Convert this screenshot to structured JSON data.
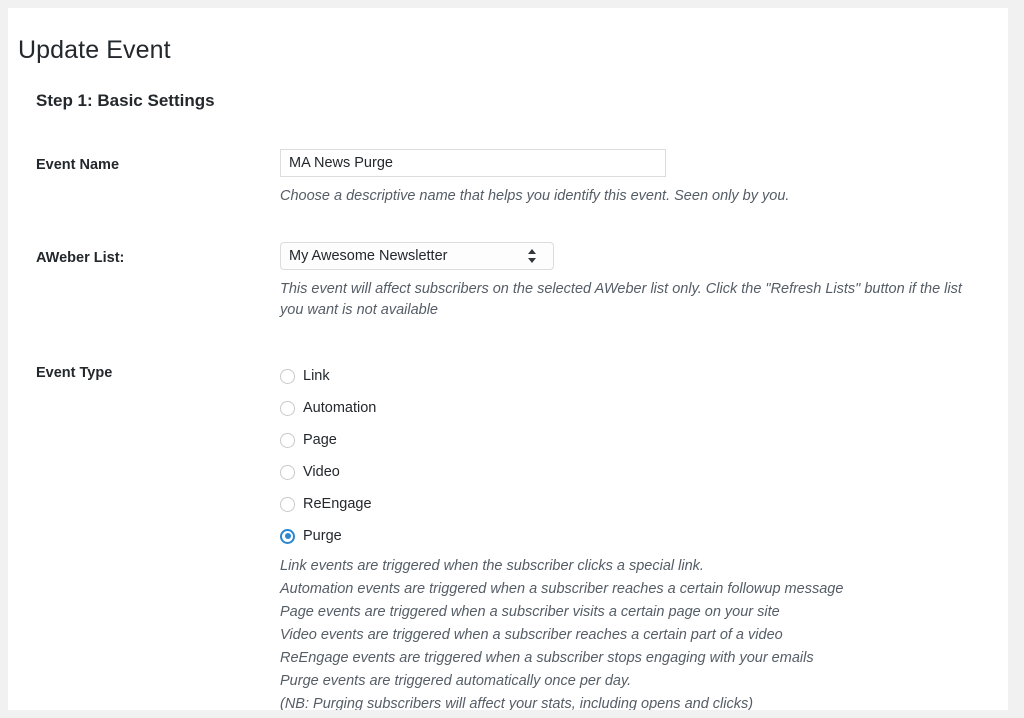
{
  "page": {
    "title": "Update Event",
    "step_title": "Step 1: Basic Settings"
  },
  "colors": {
    "accent": "#2a87d0",
    "panel_background": "#ffffff",
    "page_background": "#f1f1f1",
    "text": "#23282d",
    "help_text": "#555d66",
    "border": "#dcdcdc"
  },
  "fields": {
    "event_name": {
      "label": "Event Name",
      "value": "MA News Purge",
      "placeholder": "",
      "help": "Choose a descriptive name that helps you identify this event. Seen only by you."
    },
    "aweber_list": {
      "label": "AWeber List:",
      "selected": "My Awesome Newsletter",
      "options": [
        "My Awesome Newsletter"
      ],
      "help": "This event will affect subscribers on the selected AWeber list only. Click the \"Refresh Lists\" button if the list you want is not available",
      "arrow_icon": "select-updown-arrows-icon"
    },
    "event_type": {
      "label": "Event Type",
      "options": [
        {
          "label": "Link",
          "checked": false
        },
        {
          "label": "Automation",
          "checked": false
        },
        {
          "label": "Page",
          "checked": false
        },
        {
          "label": "Video",
          "checked": false
        },
        {
          "label": "ReEngage",
          "checked": false
        },
        {
          "label": "Purge",
          "checked": true
        }
      ],
      "descriptions": [
        "Link events are triggered when the subscriber clicks a special link.",
        "Automation events are triggered when a subscriber reaches a certain followup message",
        "Page events are triggered when a subscriber visits a certain page on your site",
        "Video events are triggered when a subscriber reaches a certain part of a video",
        "ReEngage events are triggered when a subscriber stops engaging with your emails",
        "Purge events are triggered automatically once per day.",
        "(NB: Purging subscribers will affect your stats, including opens and clicks)"
      ]
    }
  }
}
